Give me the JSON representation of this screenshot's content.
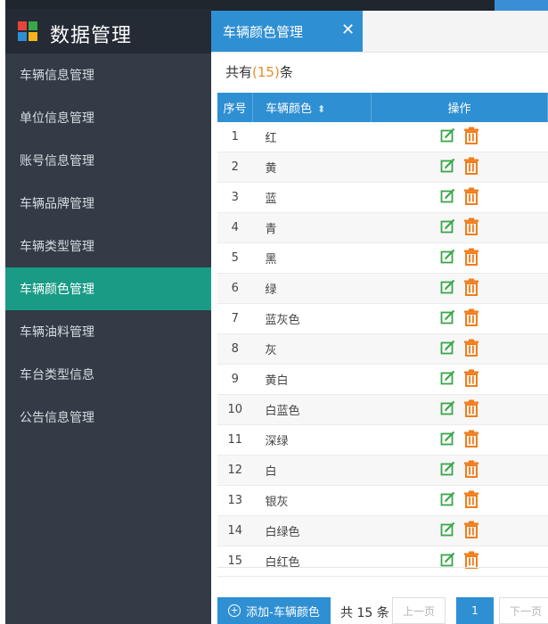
{
  "brand": {
    "title": "数据管理"
  },
  "sidebar": {
    "items": [
      {
        "label": "车辆信息管理"
      },
      {
        "label": "单位信息管理"
      },
      {
        "label": "账号信息管理"
      },
      {
        "label": "车辆品牌管理"
      },
      {
        "label": "车辆类型管理"
      },
      {
        "label": "车辆颜色管理",
        "active": true
      },
      {
        "label": "车辆油料管理"
      },
      {
        "label": "车台类型信息"
      },
      {
        "label": "公告信息管理"
      }
    ]
  },
  "tab": {
    "label": "车辆颜色管理",
    "close": "✕"
  },
  "summary": {
    "prefix": "共有",
    "count": "(15)",
    "suffix": "条"
  },
  "table": {
    "headers": {
      "no": "序号",
      "color": "车辆颜色",
      "op": "操作"
    },
    "rows": [
      {
        "no": "1",
        "color": "红"
      },
      {
        "no": "2",
        "color": "黄"
      },
      {
        "no": "3",
        "color": "蓝"
      },
      {
        "no": "4",
        "color": "青"
      },
      {
        "no": "5",
        "color": "黑"
      },
      {
        "no": "6",
        "color": "绿"
      },
      {
        "no": "7",
        "color": "蓝灰色"
      },
      {
        "no": "8",
        "color": "灰"
      },
      {
        "no": "9",
        "color": "黄白"
      },
      {
        "no": "10",
        "color": "白蓝色"
      },
      {
        "no": "11",
        "color": "深绿"
      },
      {
        "no": "12",
        "color": "白"
      },
      {
        "no": "13",
        "color": "银灰"
      },
      {
        "no": "14",
        "color": "白绿色"
      },
      {
        "no": "15",
        "color": "白红色"
      }
    ]
  },
  "footer": {
    "add_label": "添加-车辆颜色",
    "total": "共 15 条",
    "prev": "上一页",
    "page": "1",
    "next": "下一页"
  },
  "colors": {
    "sidebar_bg": "#323b46",
    "active_item": "#1a9b86",
    "primary": "#2f8fd3",
    "count_accent": "#e88c2d",
    "edit_icon": "#3aa64a",
    "delete_icon": "#f07d1c"
  },
  "icons": {
    "edit": "edit-icon",
    "delete": "trash-icon"
  }
}
